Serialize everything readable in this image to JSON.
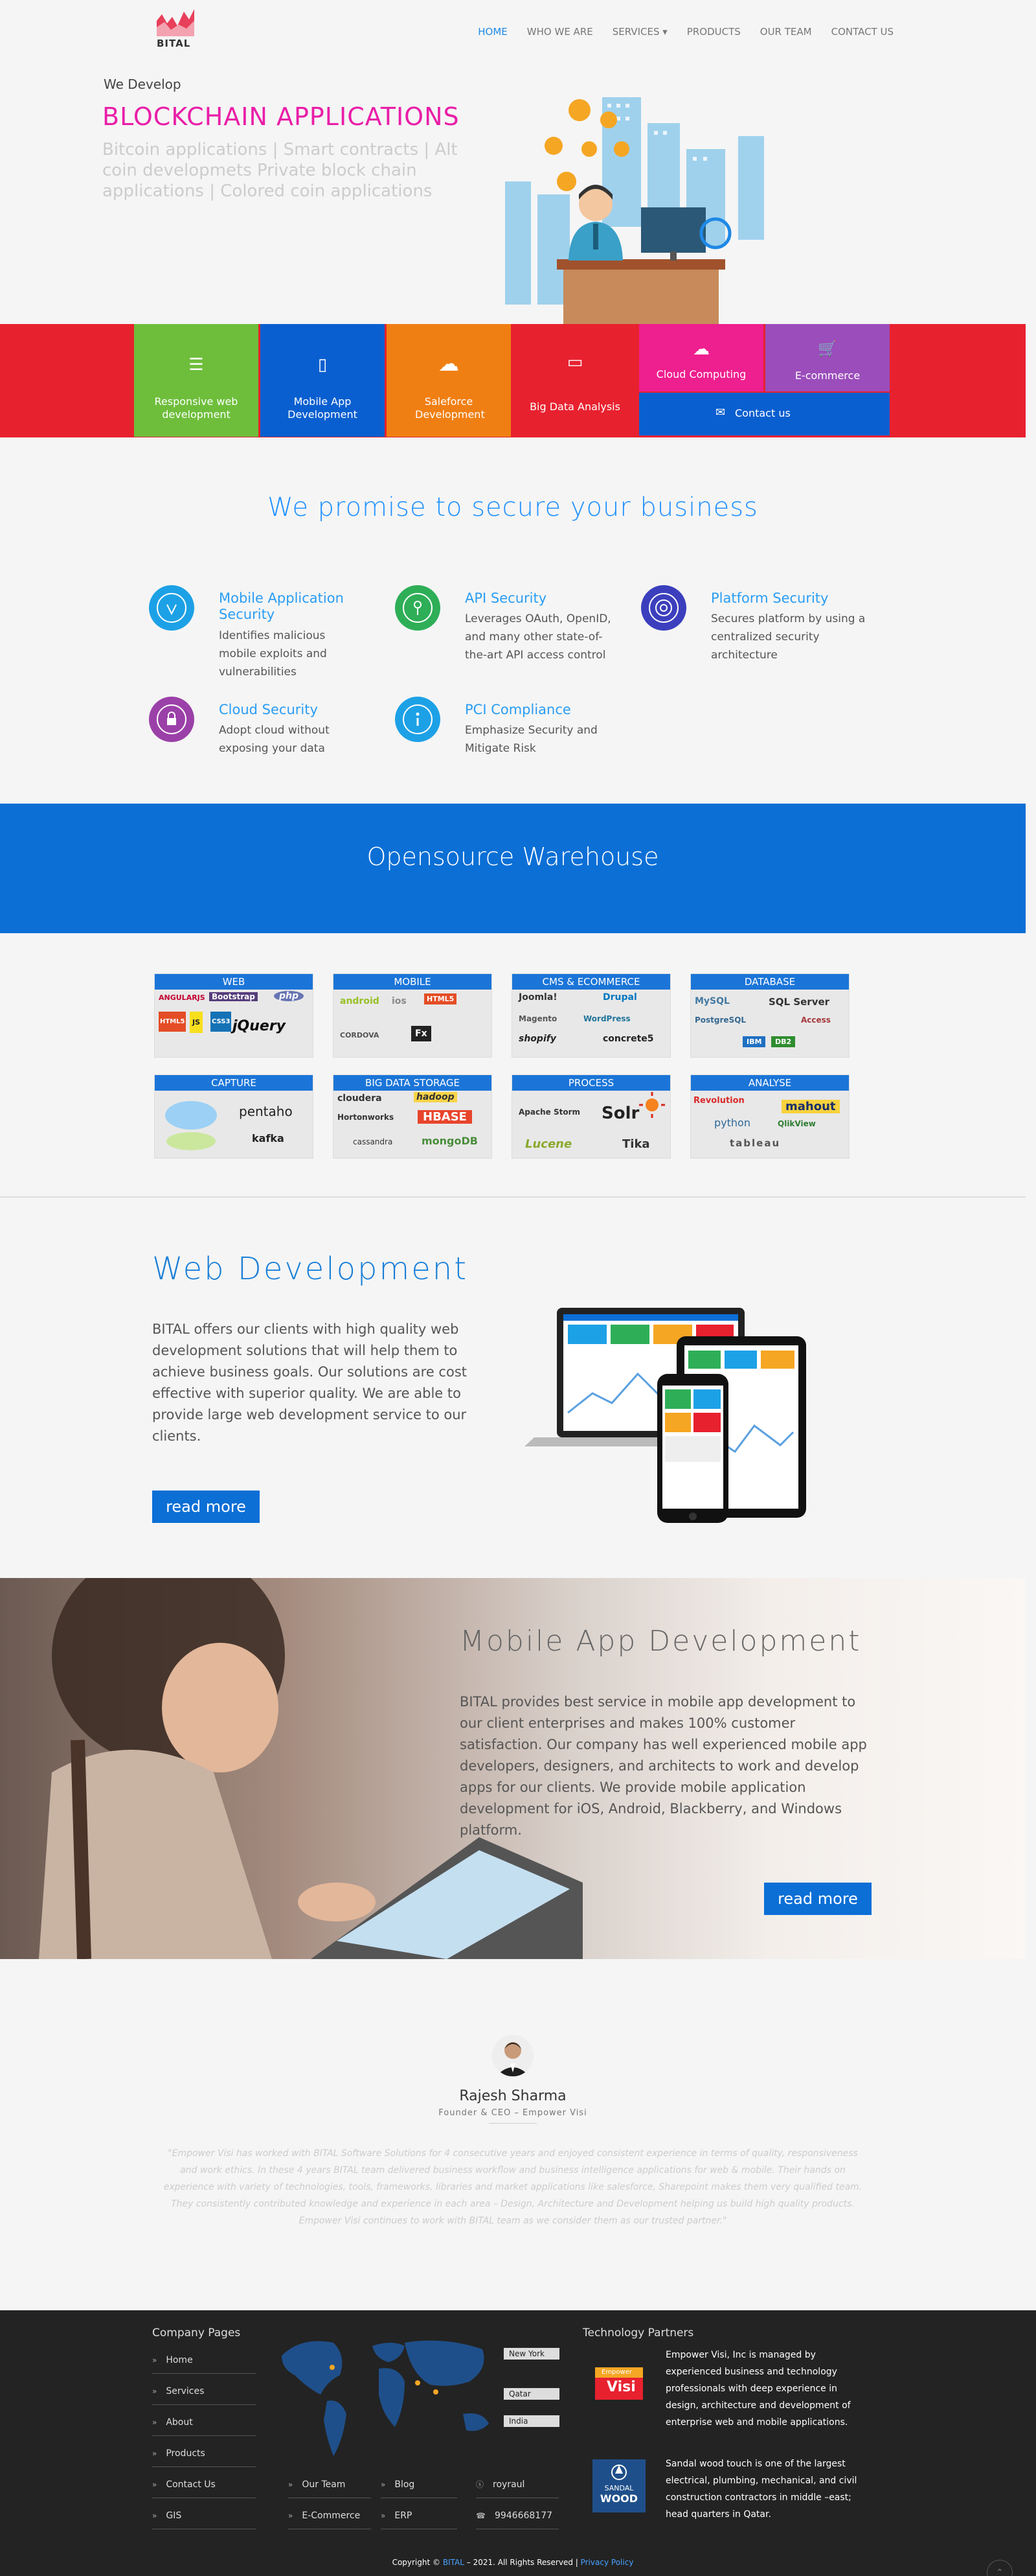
{
  "nav": {
    "logo_text": "BITAL",
    "links": [
      "HOME",
      "WHO WE ARE",
      "SERVICES ▾",
      "PRODUCTS",
      "OUR TEAM",
      "CONTACT US"
    ]
  },
  "hero": {
    "pre": "We Develop",
    "title": "BLOCKCHAIN APPLICATIONS",
    "subtitle": "Bitcoin applications | Smart contracts | Alt coin developmets Private block chain applications | Colored coin applications"
  },
  "services": [
    {
      "label": "Responsive web development",
      "color": "#6ebe3b",
      "icon": "server-icon"
    },
    {
      "label": "Mobile App Development",
      "color": "#0a5fd0",
      "icon": "mobile-icon"
    },
    {
      "label": "Saleforce Development",
      "color": "#f07f13",
      "icon": "cloud-upload-icon"
    },
    {
      "label": "Big Data Analysis",
      "color": "#e8212f",
      "icon": "chat-icon"
    },
    {
      "label": "Cloud Computing",
      "color": "#ee1f8e",
      "icon": "cloud-icon"
    },
    {
      "label": "E-commerce",
      "color": "#9b4dbb",
      "icon": "cart-icon"
    },
    {
      "label": "Contact us",
      "color": "#0a5fd0",
      "icon": "envelope-icon"
    }
  ],
  "promise": {
    "title": "We promise to secure your business",
    "features": [
      {
        "title": "Mobile Application Security",
        "desc": "Identifies malicious mobile exploits and vulnerabilities",
        "color": "#1da1e6"
      },
      {
        "title": "API Security",
        "desc": "Leverages OAuth, OpenID, and many other state-of-the-art API access control",
        "color": "#2eae57"
      },
      {
        "title": "Platform Security",
        "desc": "Secures platform by using a centralized security architecture",
        "color": "#3b3fbd"
      },
      {
        "title": "Cloud Security",
        "desc": "Adopt cloud without exposing your data",
        "color": "#9b40a8"
      },
      {
        "title": "PCI Compliance",
        "desc": "Emphasize Security and Mitigate Risk",
        "color": "#1da1e6"
      }
    ]
  },
  "warehouse": {
    "title": "Opensource Warehouse",
    "groups": [
      {
        "title": "WEB",
        "items": [
          "ANGULARJS",
          "Bootstrap",
          "php",
          "HTML5",
          "JS",
          "CSS3",
          "jQuery"
        ]
      },
      {
        "title": "MOBILE",
        "items": [
          "android",
          "ios",
          "HTML5",
          "CORDOVA",
          "Fx"
        ]
      },
      {
        "title": "CMS & ECOMMERCE",
        "items": [
          "Joomla!",
          "Drupal",
          "Magento",
          "WordPress",
          "shopify",
          "concrete5"
        ]
      },
      {
        "title": "DATABASE",
        "items": [
          "MySQL",
          "SQL Server",
          "PostgreSQL",
          "Access",
          "IBM",
          "DB2"
        ]
      },
      {
        "title": "CAPTURE",
        "items": [
          "pentaho",
          "kafka"
        ]
      },
      {
        "title": "BIG DATA STORAGE",
        "items": [
          "cloudera",
          "hadoop",
          "HBASE",
          "Hortonworks",
          "cassandra",
          "mongoDB"
        ]
      },
      {
        "title": "PROCESS",
        "items": [
          "Apache Storm",
          "Solr",
          "Lucene",
          "Tika"
        ]
      },
      {
        "title": "ANALYSE",
        "items": [
          "Revolution",
          "mahout",
          "python",
          "QlikView",
          "tableau"
        ]
      }
    ]
  },
  "webdev": {
    "title": "Web Development",
    "text": "BITAL offers our clients with high quality web development solutions that will help them to achieve business goals. Our solutions are cost effective with superior quality. We are able to provide large web development service to our clients.",
    "button": "read more"
  },
  "mobile": {
    "title": "Mobile App Development",
    "text": "BITAL provides best service in mobile app development to our client enterprises and makes 100% customer satisfaction. Our company has well experienced mobile app developers, designers, and architects to work and develop apps for our clients. We provide mobile application development for iOS, Android, Blackberry, and Windows platform.",
    "button": "read more"
  },
  "testimonial": {
    "name": "Rajesh Sharma",
    "role": "Founder & CEO – Empower Visi",
    "quote": "\"Empower Visi has worked with BITAL Software Solutions for 4 consecutive years and enjoyed consistent experience in terms of quality, responsiveness and work ethics. In these 4 years BITAL team delivered business workflow and business intelligence applications for web & mobile. Their hands on experience with variety of technologies, tools, frameworks, libraries and market applications like salesforce, Sharepoint makes them very qualified team. They consistently contributed knowledge and experience in each area – Design, Architecture and Development helping us build high quality products. Empower Visi continues to work with BITAL team as we consider them as our trusted partner.\""
  },
  "footer": {
    "pages_title": "Company Pages",
    "col1": [
      "Home",
      "Services",
      "About",
      "Products",
      "Contact Us",
      "GIS"
    ],
    "col2": [
      "Our Team",
      "E-Commerce"
    ],
    "col3": [
      "Blog",
      "ERP"
    ],
    "contact": [
      "royraul",
      "9946668177"
    ],
    "cities": [
      "New York",
      "Qatar",
      "India"
    ],
    "partners_title": "Technology Partners",
    "partner1_logo": [
      "Empower",
      "Visi"
    ],
    "partner1": "Empower Visi, Inc is managed by experienced business and technology professionals with deep experience in design, architecture and development of enterprise web and mobile applications.",
    "partner2_logo": [
      "SANDAL",
      "WOOD"
    ],
    "partner2": "Sandal wood touch is one of the largest electrical, plumbing, mechanical, and civil construction contractors in middle –east; head quarters in Qatar.",
    "copyright_prefix": "Copyright ©",
    "copyright_brand": "BITAL",
    "copyright_suffix": "– 2021. All Rights Reserved |",
    "privacy": "Privacy Policy"
  }
}
